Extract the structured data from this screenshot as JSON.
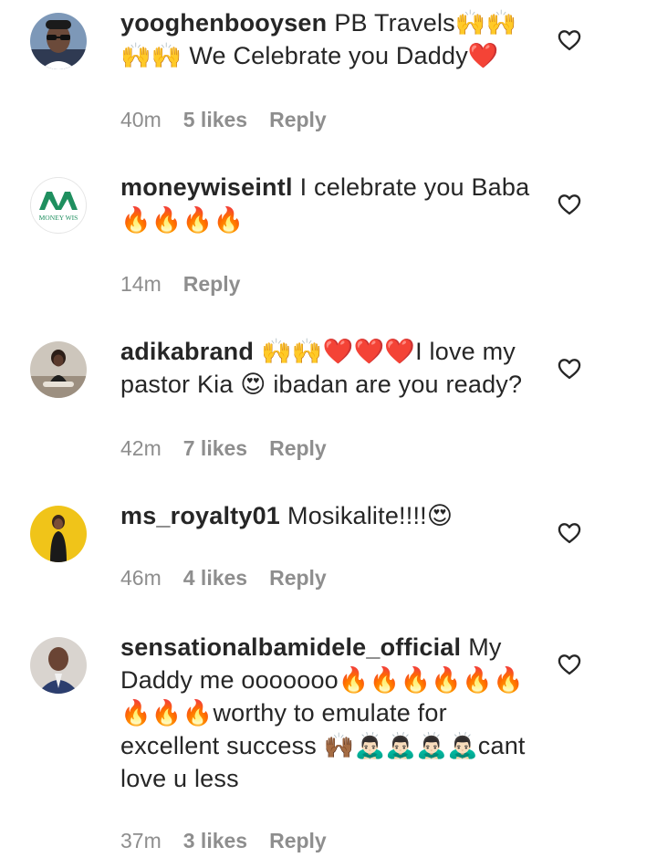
{
  "comments": [
    {
      "username": "yooghenbooysen",
      "text": "PB Travels🙌🙌🙌🙌 We Celebrate you Daddy❤️",
      "time": "40m",
      "likes": "5 likes",
      "reply": "Reply",
      "avatar": "photo-man-sunglasses"
    },
    {
      "username": "moneywiseintl",
      "text": "I celebrate you Baba 🔥🔥🔥🔥",
      "time": "14m",
      "likes": "",
      "reply": "Reply",
      "avatar": "logo-moneywise",
      "avatar_logo_text": "MONEY WIS"
    },
    {
      "username": "adikabrand",
      "text": "🙌🙌❤️❤️❤️I love my pastor Kia 😍 ibadan are you ready?",
      "time": "42m",
      "likes": "7 likes",
      "reply": "Reply",
      "avatar": "photo-woman-sitting"
    },
    {
      "username": "ms_royalty01",
      "text": "Mosikalite!!!!😍",
      "time": "46m",
      "likes": "4 likes",
      "reply": "Reply",
      "avatar": "photo-woman-yellow-bg"
    },
    {
      "username": "sensationalbamidele_official",
      "text": "My Daddy me ooooooo🔥🔥🔥🔥🔥🔥🔥🔥🔥worthy to emulate for excellent success 🙌🏾🙇🏻‍♂️🙇🏻‍♂️🙇🏻‍♂️🙇🏻‍♂️cant love u less",
      "time": "37m",
      "likes": "3 likes",
      "reply": "Reply",
      "avatar": "photo-man-suit"
    }
  ],
  "colors": {
    "text": "#262626",
    "secondary": "#8e8e8e",
    "background": "#ffffff",
    "brand_green": "#1f8f5f"
  },
  "icons": {
    "like": "heart-outline-icon"
  }
}
